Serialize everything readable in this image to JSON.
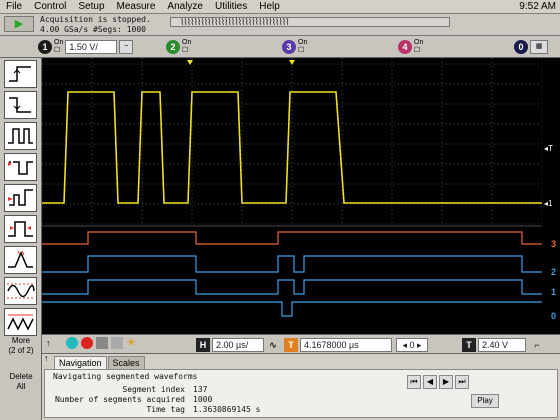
{
  "menu": {
    "items": [
      "File",
      "Control",
      "Setup",
      "Measure",
      "Analyze",
      "Utilities",
      "Help"
    ],
    "clock": "9:52 AM"
  },
  "status": {
    "line1": "Acquisition is stopped.",
    "line2": "4.00 GSa/s    #Segs: 1000"
  },
  "channels": [
    {
      "num": "1",
      "state": "On",
      "value": "1.50 V/",
      "color": "#1a1a1a"
    },
    {
      "num": "2",
      "state": "On",
      "value": "",
      "color": "#2d8a2d"
    },
    {
      "num": "3",
      "state": "On",
      "value": "",
      "color": "#5a3aa8"
    },
    {
      "num": "4",
      "state": "On",
      "value": "",
      "color": "#b8336a"
    }
  ],
  "digital_badge": "0",
  "left_toolbar": {
    "more_label": "More\n(2 of 2)",
    "more_line1": "More",
    "more_line2": "(2 of 2)",
    "delete_line1": "Delete",
    "delete_line2": "All"
  },
  "scope": {
    "trace_color": "#f0e020",
    "trigger_marker": "T",
    "digital_lines": [
      {
        "label": "3",
        "color": "#e8663a"
      },
      {
        "label": "2",
        "color": "#3aa0e8"
      },
      {
        "label": "1",
        "color": "#3aa0e8"
      },
      {
        "label": "0",
        "color": "#3aa0e8"
      }
    ]
  },
  "timebase": {
    "h_label": "H",
    "scale": "2.00 µs/",
    "delay_label": "T",
    "delay": "4.1678000 µs",
    "nav_value": "0",
    "trig_label": "T",
    "trig_level": "2.40 V"
  },
  "bottom": {
    "tabs": [
      "Navigation",
      "Scales"
    ],
    "heading": "Navigating segmented waveforms",
    "rows": [
      {
        "label": "Segment index",
        "value": "137"
      },
      {
        "label": "Number of segments acquired",
        "value": "1000"
      },
      {
        "label": "Time tag",
        "value": "1.3630869145 s"
      }
    ],
    "play_label": "Play"
  }
}
